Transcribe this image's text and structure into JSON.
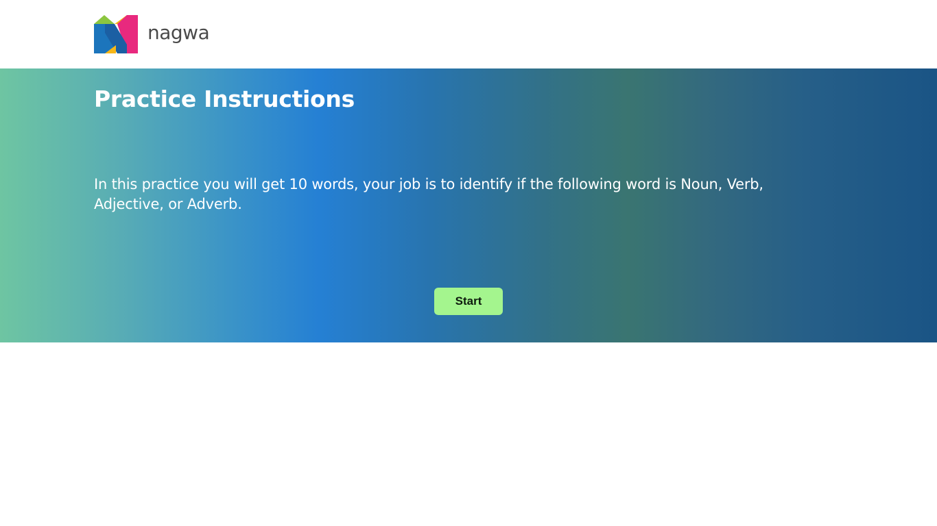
{
  "header": {
    "logo_text": "nagwa",
    "logo_icon": "nagwa-logo-icon"
  },
  "hero": {
    "title": "Practice Instructions",
    "instructions": "In this practice you will get 10 words, your job is to identify if the following word is Noun, Verb, Adjective, or Adverb.",
    "start_label": "Start"
  },
  "colors": {
    "button_bg": "#a4f58e",
    "gradient_start": "#6ec5a2",
    "gradient_mid": "#2580d4",
    "gradient_end": "#1a5485"
  }
}
